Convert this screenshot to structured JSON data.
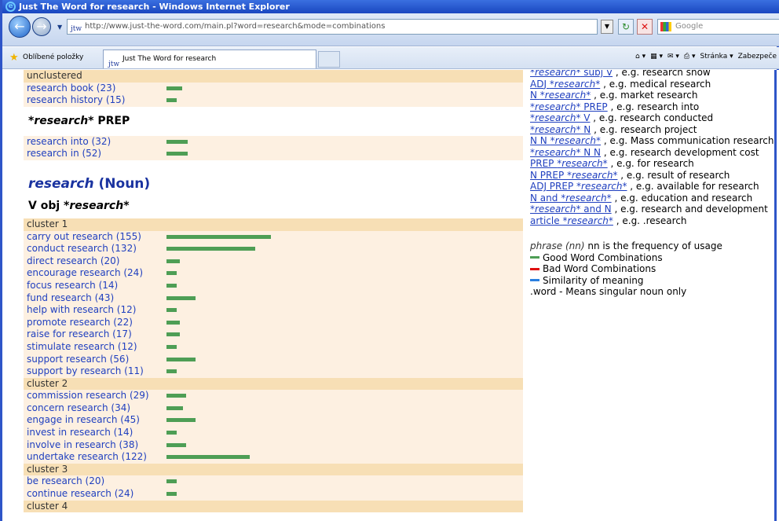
{
  "window": {
    "title": "Just The Word for research - Windows Internet Explorer"
  },
  "address": {
    "url": "http://www.just-the-word.com/main.pl?word=research&mode=combinations",
    "site_icon": "jtw",
    "search_placeholder": "Google"
  },
  "favbar": {
    "favorites_label": "Oblíbené položky",
    "tab_label": "Just The Word for research",
    "tab_icon": "jtw",
    "page_menu": "Stránka ▾",
    "safety_menu": "Zabezpeče"
  },
  "left": {
    "top_cluster": "unclustered",
    "top_items": [
      {
        "label": "research book (23)",
        "bar": 23
      },
      {
        "label": "research history (15)",
        "bar": 15
      }
    ],
    "prep_heading_pre": "*research*",
    "prep_heading_post": " PREP",
    "prep_items": [
      {
        "label": "research into (32)",
        "bar": 32
      },
      {
        "label": "research in (52)",
        "bar": 32
      }
    ],
    "noun_heading_word": "research",
    "noun_heading_rest": " (Noun)",
    "vobj_heading_pre": "V  obj ",
    "vobj_heading_word": "*research*",
    "clusters": [
      {
        "name": "cluster 1",
        "items": [
          {
            "label": "carry out research (155)",
            "bar": 155
          },
          {
            "label": "conduct research (132)",
            "bar": 132
          },
          {
            "label": "direct research (20)",
            "bar": 20
          },
          {
            "label": "encourage research (24)",
            "bar": 15
          },
          {
            "label": "focus research (14)",
            "bar": 15
          },
          {
            "label": "fund research (43)",
            "bar": 43
          },
          {
            "label": "help with research (12)",
            "bar": 15
          },
          {
            "label": "promote research (22)",
            "bar": 20
          },
          {
            "label": "raise for research (17)",
            "bar": 20
          },
          {
            "label": "stimulate research (12)",
            "bar": 15
          },
          {
            "label": "support research (56)",
            "bar": 43
          },
          {
            "label": "support by research (11)",
            "bar": 15
          }
        ]
      },
      {
        "name": "cluster 2",
        "items": [
          {
            "label": "commission research (29)",
            "bar": 29
          },
          {
            "label": "concern research (34)",
            "bar": 24
          },
          {
            "label": "engage in research (45)",
            "bar": 43
          },
          {
            "label": "invest in research (14)",
            "bar": 15
          },
          {
            "label": "involve in research (38)",
            "bar": 29
          },
          {
            "label": "undertake research (122)",
            "bar": 124
          }
        ]
      },
      {
        "name": "cluster 3",
        "items": [
          {
            "label": "be research (20)",
            "bar": 15
          },
          {
            "label": "continue research (24)",
            "bar": 15
          }
        ]
      },
      {
        "name": "cluster 4",
        "items": []
      }
    ]
  },
  "right": {
    "patterns": [
      {
        "link": "*research* subj V",
        "text": " , e.g.  research show"
      },
      {
        "link": "ADJ *research*",
        "text": " , e.g.  medical research"
      },
      {
        "link": "N *research*",
        "text": " , e.g.  market research"
      },
      {
        "link": "*research* PREP",
        "text": " , e.g.  research into"
      },
      {
        "link": "*research* V",
        "text": " , e.g.  research conducted"
      },
      {
        "link": "*research* N",
        "text": " , e.g.  research project"
      },
      {
        "link": "N N *research*",
        "text": " , e.g.  Mass communication research"
      },
      {
        "link": "*research* N N",
        "text": " , e.g.  research development cost"
      },
      {
        "link": "PREP *research*",
        "text": " , e.g.  for research"
      },
      {
        "link": "N PREP *research*",
        "text": " , e.g.  result of research"
      },
      {
        "link": "ADJ PREP *research*",
        "text": " , e.g.  available for research"
      },
      {
        "link": "N and *research*",
        "text": " , e.g.  education and research"
      },
      {
        "link": "*research* and N",
        "text": " , e.g.  research and development"
      },
      {
        "link": "article *research*",
        "text": " , e.g.  .research"
      }
    ],
    "legend": {
      "phrase_italic": "phrase (nn)",
      "phrase_rest": " nn is the frequency of usage",
      "good": "Good Word Combinations",
      "bad": "Bad Word Combinations",
      "similar": "Similarity of meaning",
      "singular": ".word - Means singular noun only",
      "colors": {
        "good": "#4e9e55",
        "bad": "#e01010",
        "similar": "#2a7fe0"
      }
    }
  }
}
